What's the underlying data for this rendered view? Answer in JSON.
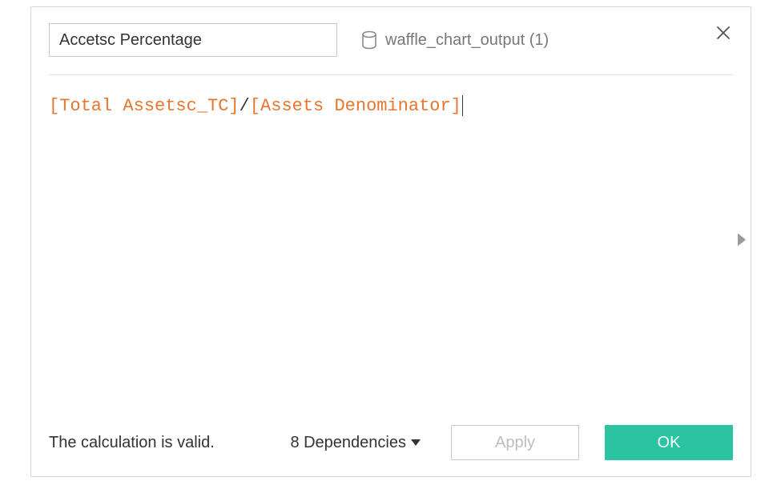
{
  "header": {
    "name_value": "Accetsc Percentage",
    "datasource_label": "waffle_chart_output (1)"
  },
  "formula": {
    "tokens": [
      {
        "text": "[Total Assetsc_TC]",
        "kind": "field"
      },
      {
        "text": "/",
        "kind": "op"
      },
      {
        "text": "[Assets Denominator]",
        "kind": "field"
      }
    ]
  },
  "footer": {
    "status_text": "The calculation is valid.",
    "dependencies_label": "8 Dependencies",
    "apply_label": "Apply",
    "ok_label": "OK"
  }
}
